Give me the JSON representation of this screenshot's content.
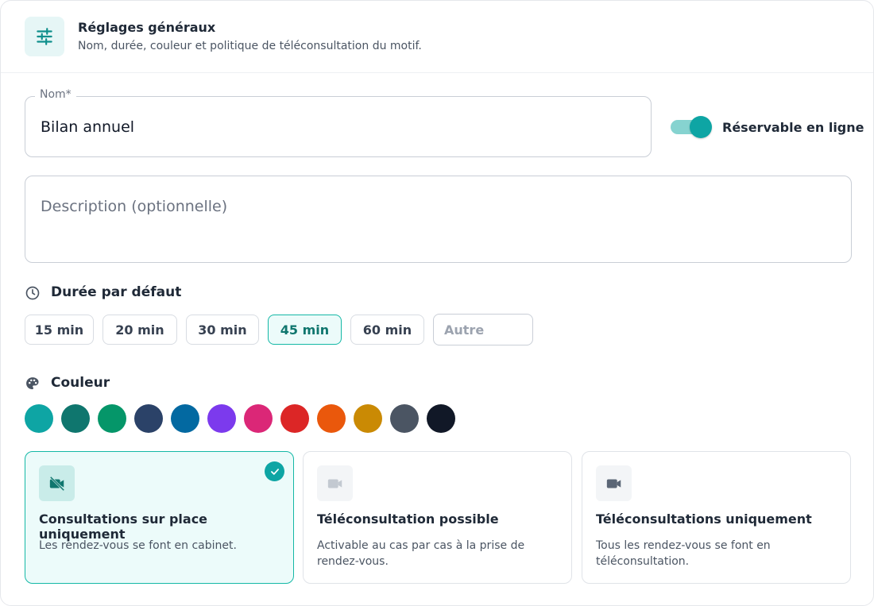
{
  "header": {
    "title": "Réglages généraux",
    "subtitle": "Nom, durée, couleur et politique de téléconsultation du motif.",
    "icon": "sliders-icon"
  },
  "nom": {
    "label": "Nom*",
    "value": "Bilan annuel"
  },
  "toggle": {
    "label": "Réservable en ligne",
    "on": true
  },
  "description": {
    "placeholder": "Description (optionnelle)"
  },
  "duration": {
    "title": "Durée par défaut",
    "icon": "clock-icon",
    "options": [
      "15 min",
      "20 min",
      "30 min",
      "45 min",
      "60 min"
    ],
    "selected": "45 min",
    "custom_placeholder": "Autre"
  },
  "color": {
    "title": "Couleur",
    "icon": "palette-icon",
    "swatches": [
      "#0ea5a4",
      "#0f766e",
      "#059669",
      "#2b4268",
      "#0369a1",
      "#7c3aed",
      "#db2777",
      "#dc2626",
      "#ea580c",
      "#ca8a04",
      "#4b5563",
      "#111827"
    ]
  },
  "consultation": {
    "options": [
      {
        "title": "Consultations sur place uniquement",
        "desc": "Les rendez-vous se font en cabinet.",
        "icon": "video-off-icon",
        "selected": true
      },
      {
        "title": "Téléconsultation possible",
        "desc": "Activable au cas par cas à la prise de rendez-vous.",
        "icon": "video-icon",
        "selected": false
      },
      {
        "title": "Téléconsultations uniquement",
        "desc": "Tous les rendez-vous se font en téléconsultation.",
        "icon": "video-icon",
        "selected": false
      }
    ]
  },
  "colors": {
    "accent": "#0ea5a4",
    "accent_bg": "#ecfbfa",
    "text": "#1f2937",
    "muted": "#4b5563"
  }
}
